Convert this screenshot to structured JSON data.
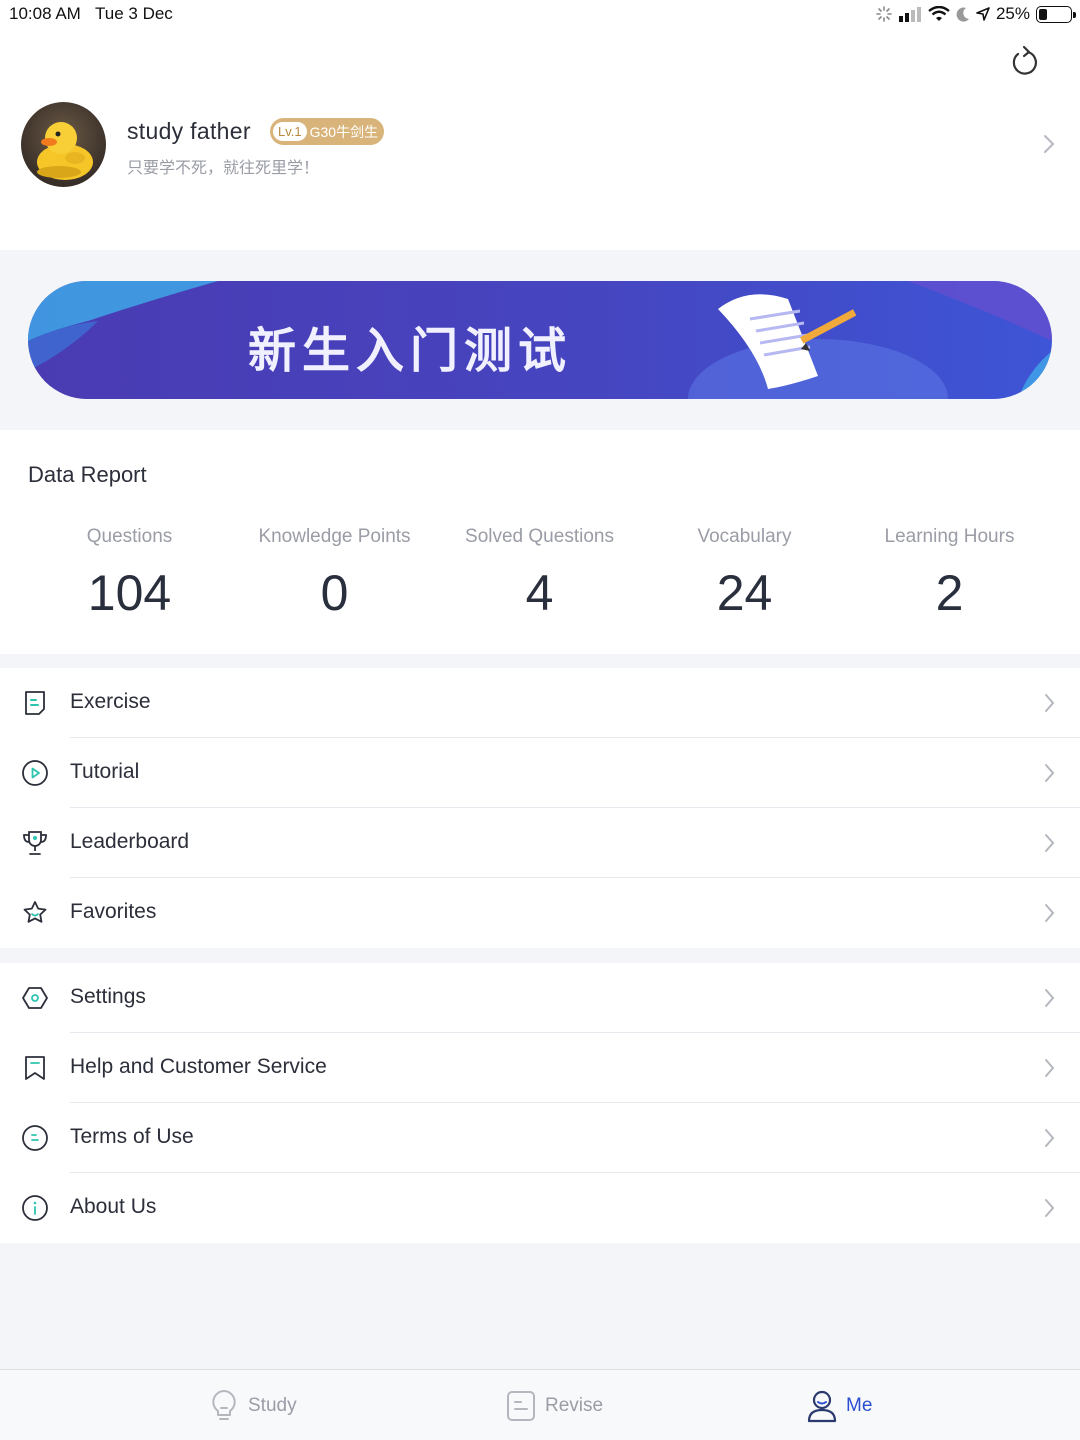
{
  "status_bar": {
    "time": "10:08 AM",
    "date": "Tue 3 Dec",
    "battery": "25%",
    "battery_level": 0.25
  },
  "profile": {
    "name": "study father",
    "level": "Lv.1",
    "badge": "G30牛剑生",
    "motto": "只要学不死，就往死里学！"
  },
  "banner": {
    "title": "新生入门测试"
  },
  "report": {
    "title": "Data Report",
    "stats": [
      {
        "label": "Questions",
        "value": "104"
      },
      {
        "label": "Knowledge Points",
        "value": "0"
      },
      {
        "label": "Solved Questions",
        "value": "4"
      },
      {
        "label": "Vocabulary",
        "value": "24"
      },
      {
        "label": "Learning Hours",
        "value": "2"
      }
    ]
  },
  "menu_primary": [
    {
      "label": "Exercise",
      "icon": "exercise-icon"
    },
    {
      "label": "Tutorial",
      "icon": "play-circle-icon"
    },
    {
      "label": "Leaderboard",
      "icon": "trophy-icon"
    },
    {
      "label": "Favorites",
      "icon": "star-icon"
    }
  ],
  "menu_secondary": [
    {
      "label": "Settings",
      "icon": "settings-icon"
    },
    {
      "label": "Help and Customer Service",
      "icon": "bookmark-icon"
    },
    {
      "label": "Terms of Use",
      "icon": "document-circle-icon"
    },
    {
      "label": "About Us",
      "icon": "info-icon"
    }
  ],
  "tabs": [
    {
      "label": "Study",
      "icon": "lightbulb-icon"
    },
    {
      "label": "Revise",
      "icon": "notes-icon"
    },
    {
      "label": "Me",
      "icon": "user-icon",
      "active": true
    }
  ],
  "colors": {
    "accent": "#2b4fd0",
    "icon_teal": "#2ec5b0",
    "banner_start": "#4a3bb2",
    "banner_end": "#3d55d6",
    "badge_gold": "#d9b47a"
  }
}
